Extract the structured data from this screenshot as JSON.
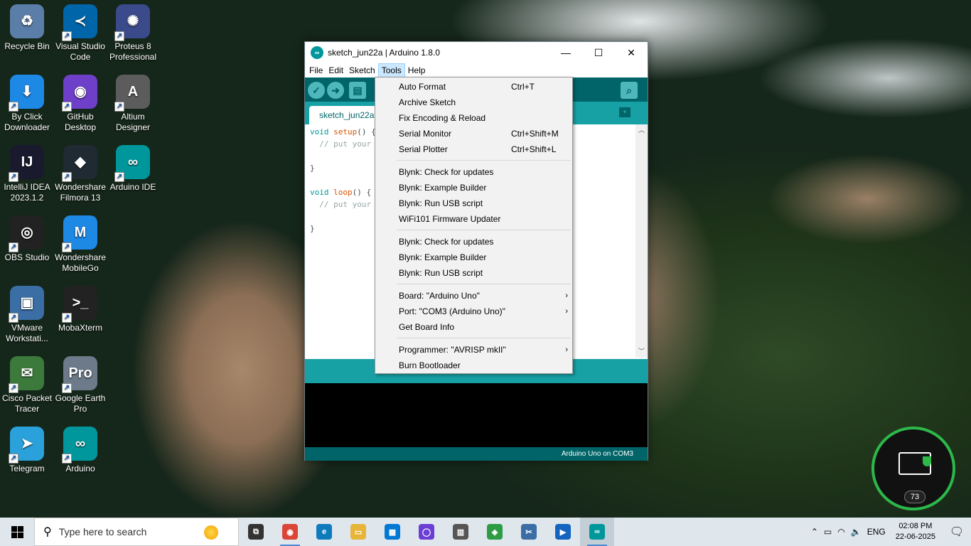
{
  "desktop": {
    "icons": [
      {
        "label": "Recycle Bin",
        "glyph": "♻"
      },
      {
        "label": "Visual Studio Code",
        "glyph": "≺"
      },
      {
        "label": "Proteus 8 Professional",
        "glyph": "✺"
      },
      {
        "label": "By Click Downloader",
        "glyph": "⬇"
      },
      {
        "label": "GitHub Desktop",
        "glyph": "◉"
      },
      {
        "label": "Altium Designer",
        "glyph": "A"
      },
      {
        "label": "IntelliJ IDEA 2023.1.2",
        "glyph": "IJ"
      },
      {
        "label": "Wondershare Filmora 13",
        "glyph": "◆"
      },
      {
        "label": "Arduino IDE",
        "glyph": "∞"
      },
      {
        "label": "OBS Studio",
        "glyph": "◎"
      },
      {
        "label": "Wondershare MobileGo",
        "glyph": "M"
      },
      {
        "label": "VMware Workstati...",
        "glyph": "▣"
      },
      {
        "label": "MobaXterm",
        "glyph": ">_"
      },
      {
        "label": "Cisco Packet Tracer",
        "glyph": "✉"
      },
      {
        "label": "Google Earth Pro",
        "glyph": "Pro"
      },
      {
        "label": "Telegram",
        "glyph": "➤"
      },
      {
        "label": "Arduino",
        "glyph": "∞"
      }
    ]
  },
  "window": {
    "title": "sketch_jun22a | Arduino 1.8.0",
    "app_icon": "∞",
    "minimize": "—",
    "maximize": "☐",
    "close": "✕",
    "menus": [
      "File",
      "Edit",
      "Sketch",
      "Tools",
      "Help"
    ],
    "toolbar": {
      "verify": "✓",
      "upload": "➜",
      "new": "▤",
      "open": "▲",
      "save": "▼",
      "serial": "⌕"
    },
    "tab_label": "sketch_jun22a",
    "tab_menu": "▼",
    "code_lines": [
      {
        "kw": "void ",
        "fn": "setup",
        "rest": "() {",
        "cm": ""
      },
      {
        "kw": "",
        "fn": "",
        "rest": "  ",
        "cm": "// put your"
      },
      {
        "kw": "",
        "fn": "",
        "rest": "",
        "cm": ""
      },
      {
        "kw": "",
        "fn": "",
        "rest": "}",
        "cm": ""
      },
      {
        "kw": "",
        "fn": "",
        "rest": "",
        "cm": ""
      },
      {
        "kw": "void ",
        "fn": "loop",
        "rest": "() {",
        "cm": ""
      },
      {
        "kw": "",
        "fn": "",
        "rest": "  ",
        "cm": "// put your"
      },
      {
        "kw": "",
        "fn": "",
        "rest": "",
        "cm": ""
      },
      {
        "kw": "",
        "fn": "",
        "rest": "}",
        "cm": ""
      }
    ],
    "scroll_up": "︿",
    "scroll_down": "﹀",
    "footer_status": "Arduino Uno on COM3"
  },
  "tools_menu": {
    "groups": [
      [
        {
          "label": "Auto Format",
          "shortcut": "Ctrl+T",
          "submenu": false
        },
        {
          "label": "Archive Sketch",
          "shortcut": "",
          "submenu": false
        },
        {
          "label": "Fix Encoding & Reload",
          "shortcut": "",
          "submenu": false
        },
        {
          "label": "Serial Monitor",
          "shortcut": "Ctrl+Shift+M",
          "submenu": false
        },
        {
          "label": "Serial Plotter",
          "shortcut": "Ctrl+Shift+L",
          "submenu": false
        }
      ],
      [
        {
          "label": "Blynk: Check for updates",
          "shortcut": "",
          "submenu": false
        },
        {
          "label": "Blynk: Example Builder",
          "shortcut": "",
          "submenu": false
        },
        {
          "label": "Blynk: Run USB script",
          "shortcut": "",
          "submenu": false
        },
        {
          "label": "WiFi101 Firmware Updater",
          "shortcut": "",
          "submenu": false
        }
      ],
      [
        {
          "label": "Blynk: Check for updates",
          "shortcut": "",
          "submenu": false
        },
        {
          "label": "Blynk: Example Builder",
          "shortcut": "",
          "submenu": false
        },
        {
          "label": "Blynk: Run USB script",
          "shortcut": "",
          "submenu": false
        }
      ],
      [
        {
          "label": "Board: \"Arduino Uno\"",
          "shortcut": "",
          "submenu": true
        },
        {
          "label": "Port: \"COM3 (Arduino Uno)\"",
          "shortcut": "",
          "submenu": true
        },
        {
          "label": "Get Board Info",
          "shortcut": "",
          "submenu": false
        }
      ],
      [
        {
          "label": "Programmer: \"AVRISP mkII\"",
          "shortcut": "",
          "submenu": true
        },
        {
          "label": "Burn Bootloader",
          "shortcut": "",
          "submenu": false
        }
      ]
    ],
    "submenu_arrow": "›"
  },
  "taskbar": {
    "search_placeholder": "Type here to search",
    "apps": [
      {
        "name": "task-view",
        "glyph": "⧉",
        "color": "#333333"
      },
      {
        "name": "chrome",
        "glyph": "◉",
        "color": "#db4437"
      },
      {
        "name": "edge",
        "glyph": "e",
        "color": "#0f7bbd"
      },
      {
        "name": "file-explorer",
        "glyph": "▭",
        "color": "#e8b53b"
      },
      {
        "name": "microsoft-store",
        "glyph": "▦",
        "color": "#0078d4"
      },
      {
        "name": "cortana",
        "glyph": "◯",
        "color": "#6b3fd6"
      },
      {
        "name": "calculator",
        "glyph": "▥",
        "color": "#555555"
      },
      {
        "name": "bluestacks",
        "glyph": "◈",
        "color": "#2e9b45"
      },
      {
        "name": "snipping-tool",
        "glyph": "✂",
        "color": "#3a6ea5"
      },
      {
        "name": "video-editor",
        "glyph": "▶",
        "color": "#1565c0"
      },
      {
        "name": "arduino",
        "glyph": "∞",
        "color": "#00979c"
      }
    ],
    "tray": {
      "chevron": "⌃",
      "battery": "▭",
      "wifi": "◠",
      "volume": "🔈",
      "lang": "ENG"
    },
    "time": "02:08 PM",
    "date": "22-06-2025",
    "notification": "🗨"
  },
  "widget": {
    "value": "73"
  }
}
